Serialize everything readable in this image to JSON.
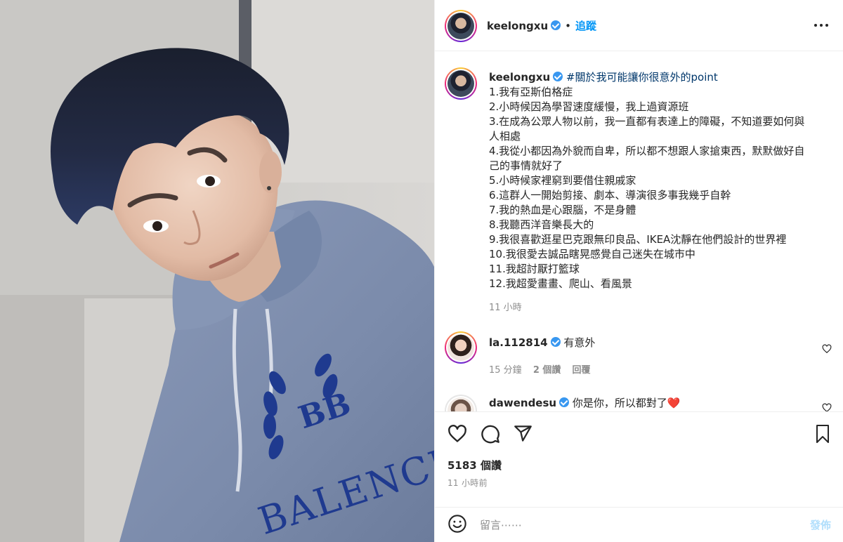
{
  "post": {
    "author": {
      "username": "keelongxu",
      "verified": true,
      "follow_label": "追蹤",
      "separator": "•"
    },
    "caption": {
      "hashtag": "#關於我可能讓你很意外的point",
      "lines": [
        "1.我有亞斯伯格症",
        "2.小時候因為學習速度緩慢，我上過資源班",
        "3.在成為公眾人物以前，我一直都有表達上的障礙，不知道要如何與",
        "人相處",
        "4.我從小都因為外貌而自卑，所以都不想跟人家搶東西，默默做好自",
        "己的事情就好了",
        "5.小時候家裡窮到要借住親戚家",
        "6.這群人一開始剪接、劇本、導演很多事我幾乎自幹",
        "7.我的熱血是心跟腦，不是身體",
        "8.我聽西洋音樂長大的",
        "9.我很喜歡逛星巴克跟無印良品、IKEA沈靜在他們設計的世界裡",
        "10.我很愛去誠品瞎晃感覺自己迷失在城市中",
        "11.我超討厭打籃球",
        "12.我超愛畫畫、爬山、看風景"
      ],
      "time": "11 小時"
    },
    "comments": [
      {
        "username": "la.112814",
        "verified": true,
        "text": "有意外",
        "time": "15 分鐘",
        "likes": "2 個讚",
        "reply_label": "回覆"
      },
      {
        "username": "dawendesu",
        "verified": true,
        "text": "你是你，所以都對了❤️"
      }
    ],
    "likes_count": "5183 個讚",
    "posted_ago": "11 小時前",
    "composer": {
      "placeholder": "留言⋯⋯",
      "post_label": "發佈"
    },
    "photo": {
      "hoodie_text": "BALENCIAGA",
      "logo_text": "BB"
    },
    "colors": {
      "link_blue": "#0095f6",
      "verified_blue": "#3897f0",
      "hoodie": "#7f8fb0",
      "hoodie_print": "#1f3a8f",
      "like_red": "#ed4956"
    }
  }
}
